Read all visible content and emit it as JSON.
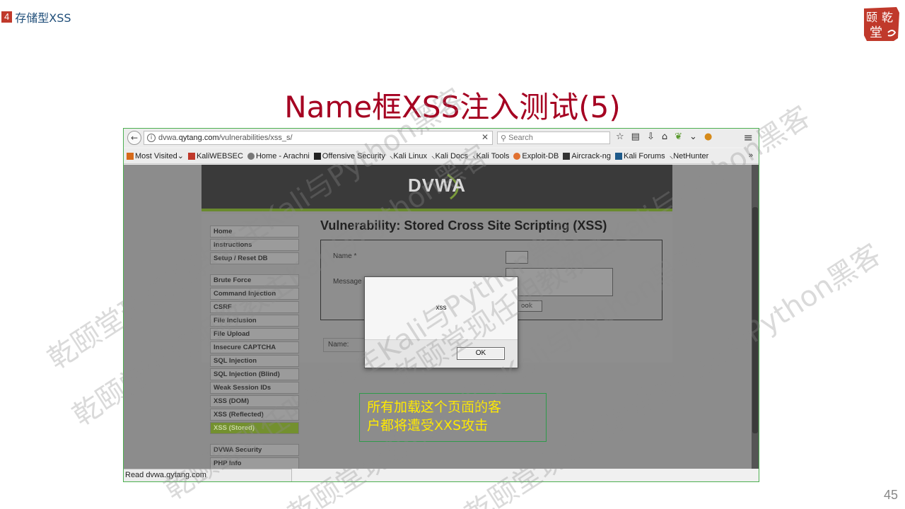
{
  "slide": {
    "section_number": "4",
    "section_title": "存储型XSS",
    "title": "Name框XSS注入测试(5)",
    "page_number": "45",
    "logo_text": [
      "颐",
      "乾",
      "堂"
    ]
  },
  "browser": {
    "url_prefix": "dvwa.",
    "url_domain": "qytang.com",
    "url_path": "/vulnerabilities/xss_s/",
    "search_placeholder": "Search",
    "bookmarks": [
      {
        "label": "Most Visited",
        "icon": "most-visited-icon"
      },
      {
        "label": "KaliWEBSEC",
        "icon": "kali-websec-icon"
      },
      {
        "label": "Home - Arachni",
        "icon": "arachni-icon"
      },
      {
        "label": "Offensive Security",
        "icon": "offsec-icon"
      },
      {
        "label": "Kali Linux",
        "icon": "kali-dragon-icon"
      },
      {
        "label": "Kali Docs",
        "icon": "kali-dragon-icon"
      },
      {
        "label": "Kali Tools",
        "icon": "kali-dragon-icon"
      },
      {
        "label": "Exploit-DB",
        "icon": "exploit-db-icon"
      },
      {
        "label": "Aircrack-ng",
        "icon": "aircrack-icon"
      },
      {
        "label": "Kali Forums",
        "icon": "kali-forums-icon"
      },
      {
        "label": "NetHunter",
        "icon": "kali-dragon-icon"
      }
    ],
    "bookmarks_more": "»",
    "status_text": "Read dvwa.qytang.com"
  },
  "dvwa": {
    "logo": "DVWA",
    "vuln_title": "Vulnerability: Stored Cross Site Scripting (XSS)",
    "menu_group1": [
      "Home",
      "Instructions",
      "Setup / Reset DB"
    ],
    "menu_group2": [
      "Brute Force",
      "Command Injection",
      "CSRF",
      "File Inclusion",
      "File Upload",
      "Insecure CAPTCHA",
      "SQL Injection",
      "SQL Injection (Blind)",
      "Weak Session IDs",
      "XSS (DOM)",
      "XSS (Reflected)",
      "XSS (Stored)"
    ],
    "menu_group3": [
      "DVWA Security",
      "PHP Info"
    ],
    "name_label": "Name *",
    "message_label": "Message",
    "sign_button": "ook",
    "guestbook_entry": "Name:"
  },
  "alert": {
    "message": "xss",
    "ok_label": "OK"
  },
  "annotation": {
    "line1": "所有加载这个页面的客",
    "line2": "户都将遭受XXS攻击"
  },
  "watermark": {
    "text": "乾颐堂现任明教教主Kali与Python黑客"
  }
}
